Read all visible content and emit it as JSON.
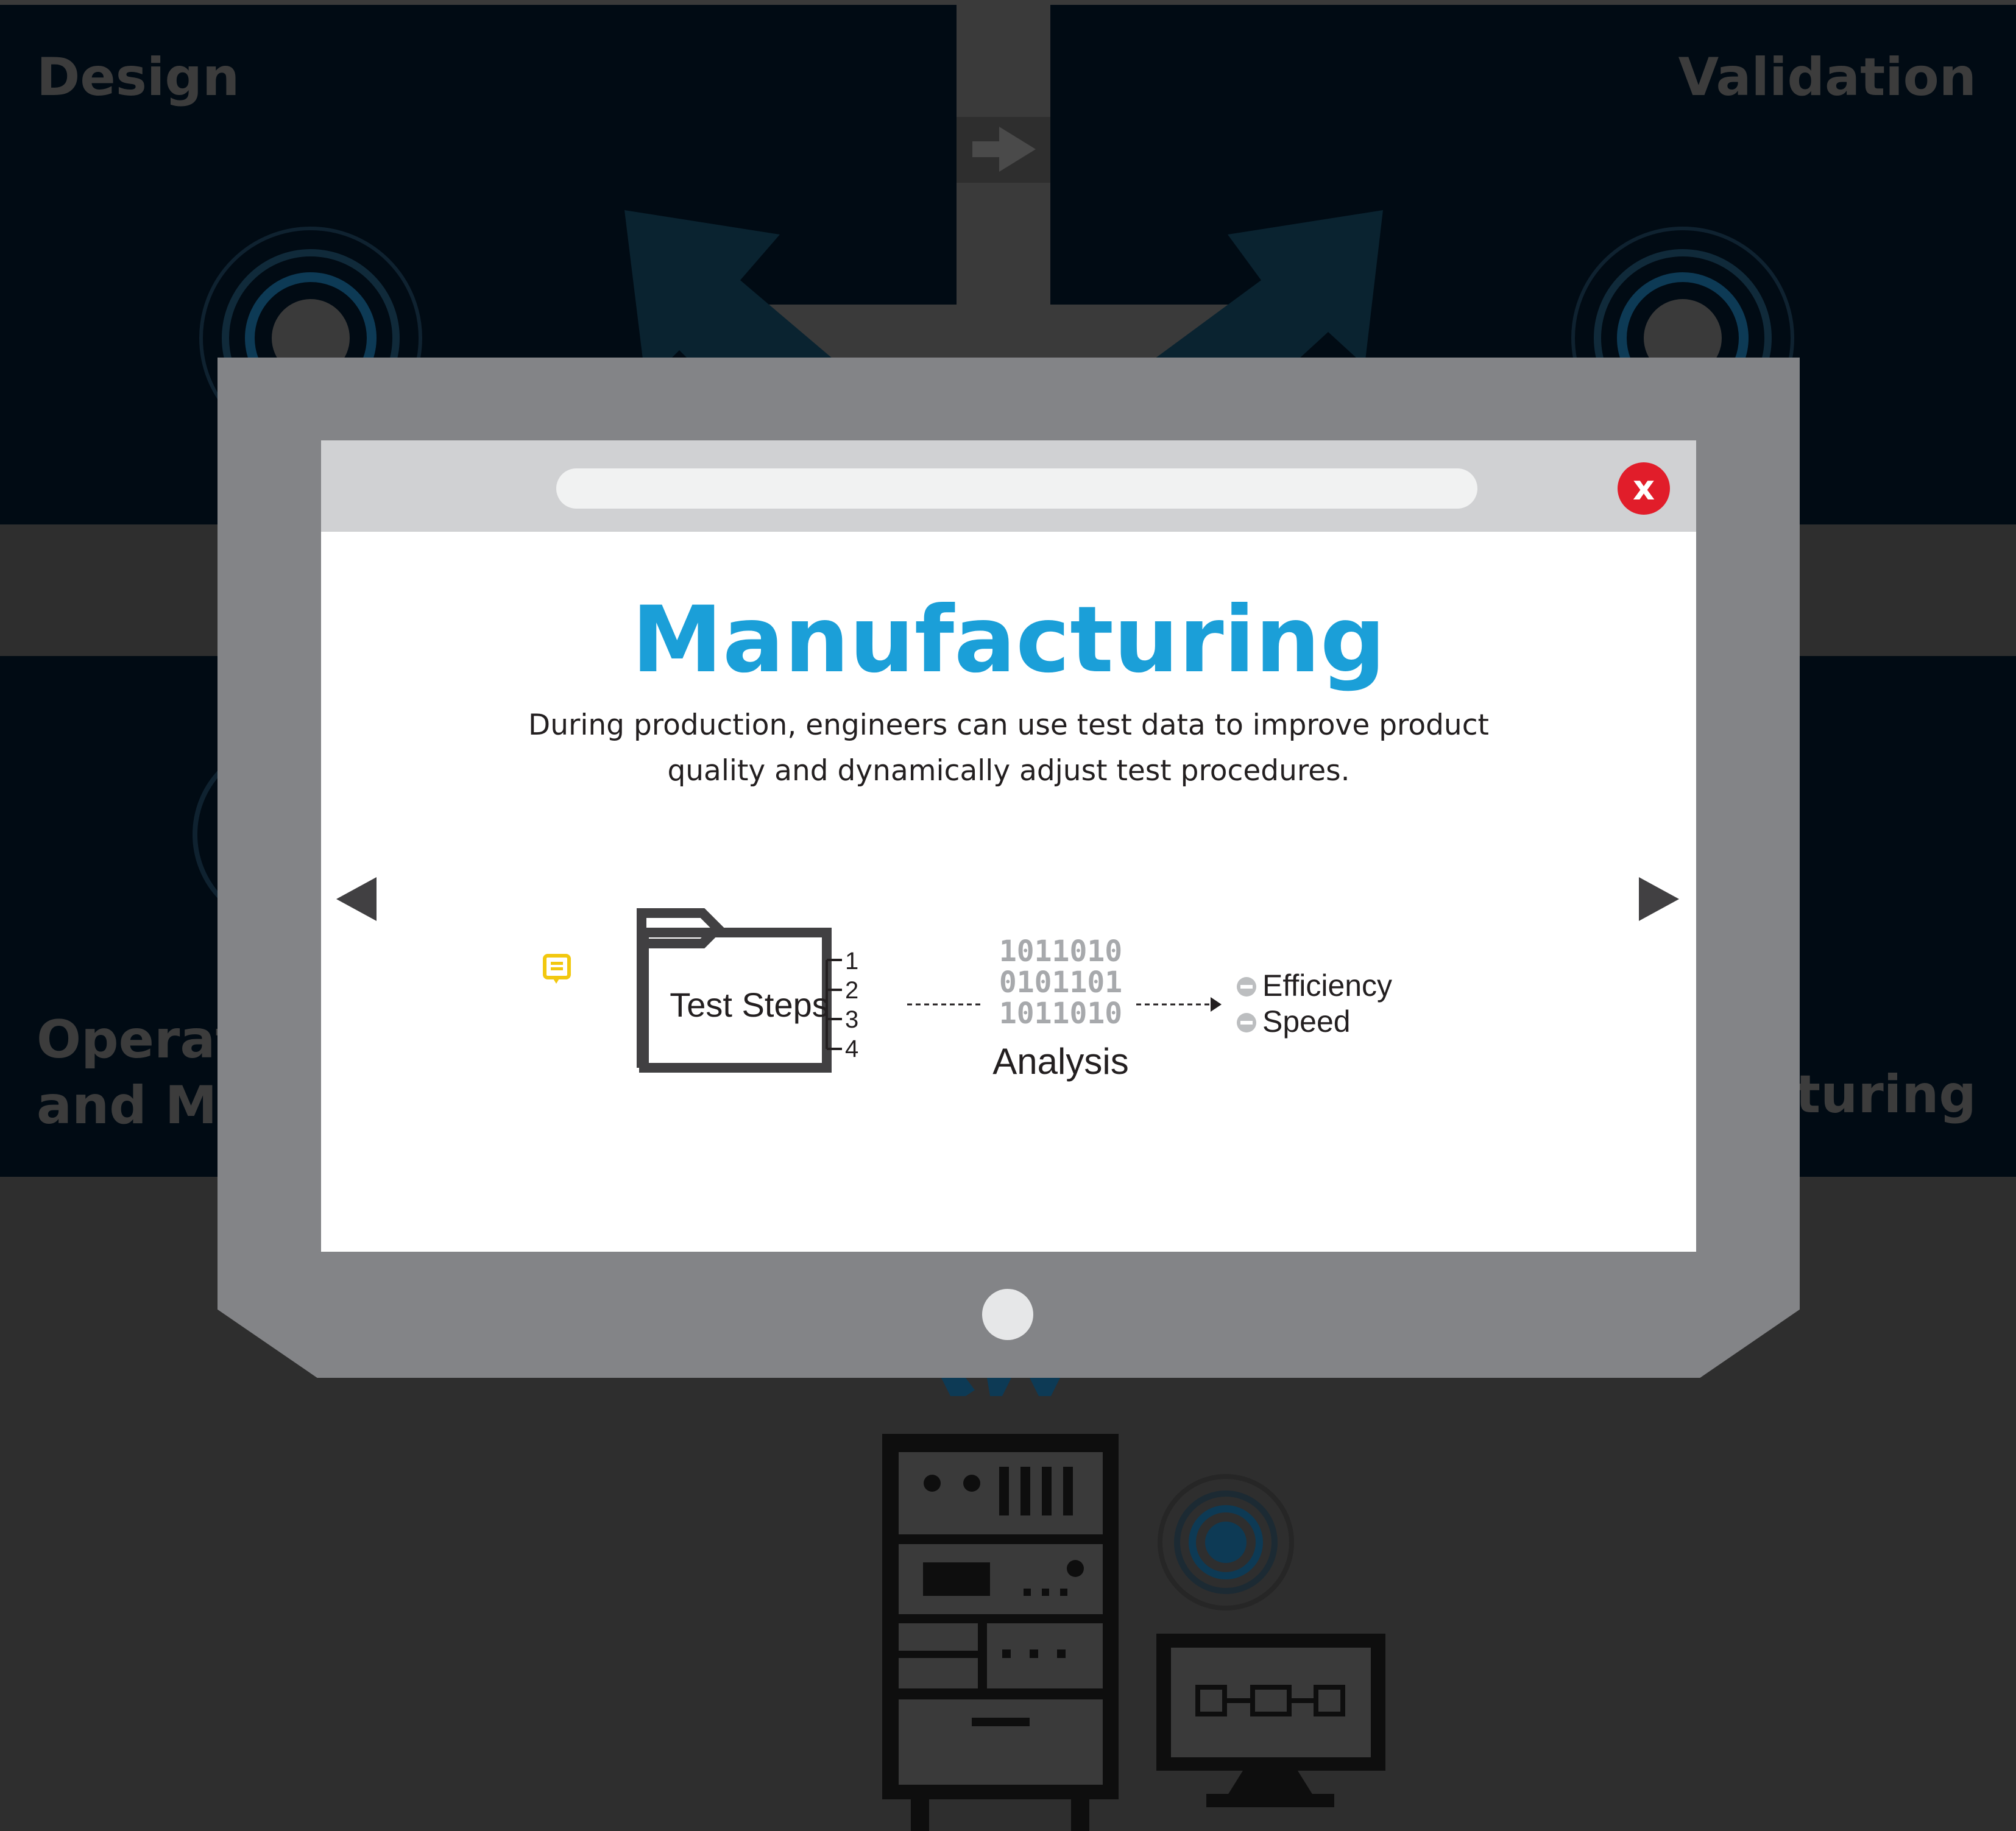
{
  "background": {
    "stages": {
      "design": "Design",
      "validation": "Validation",
      "operations_line1": "Operat",
      "operations_line2": "and Ma",
      "manufacturing_partial": "cturing"
    }
  },
  "browser": {
    "close_label": "x"
  },
  "modal": {
    "title": "Manufacturing",
    "description_line1": "During production, engineers can use test data to improve product",
    "description_line2": "quality and dynamically adjust test procedures."
  },
  "diagram": {
    "folder_label": "Test Steps",
    "step_numbers": [
      "1",
      "2",
      "3",
      "4"
    ],
    "binary_lines": [
      "1011010",
      "0101101",
      "1011010"
    ],
    "analysis_label": "Analysis",
    "outcomes": [
      "Efficiency",
      "Speed"
    ]
  },
  "colors": {
    "accent": "#1b9fd8",
    "close": "#e11d2a",
    "comment": "#f2c80f",
    "panel": "#010b14",
    "backdrop": "#2e2e2e",
    "bezel": "#838487"
  },
  "icons": {
    "prev": "triangle-left-icon",
    "next": "triangle-right-icon",
    "close": "close-icon",
    "comment": "comment-icon",
    "folder": "folder-icon"
  }
}
